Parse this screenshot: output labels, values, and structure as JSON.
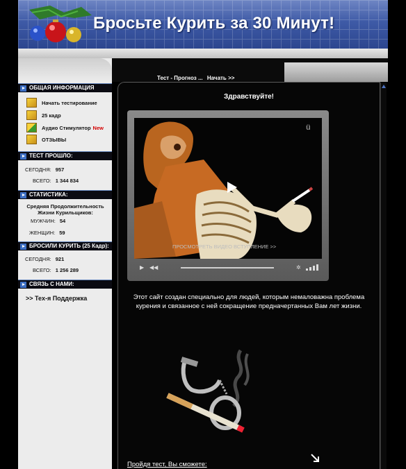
{
  "header": {
    "title": "Бросьте Курить за 30 Минут!"
  },
  "breadcrumb": {
    "test": "Тест - Прогноз ...",
    "start": "Начать >>"
  },
  "sidebar": {
    "general": {
      "heading": "ОБЩАЯ ИНФОРМАЦИЯ",
      "items": [
        {
          "label": "Начать тестирование",
          "icon": "cube-icon"
        },
        {
          "label": "25 кадр",
          "icon": "cube-icon"
        },
        {
          "label": "Аудио Стимулятор",
          "badge": "New",
          "icon": "cube-icon"
        },
        {
          "label": "ОТЗЫВЫ",
          "icon": "cube-icon"
        }
      ]
    },
    "test_passed": {
      "heading": "ТЕСТ ПРОШЛО:",
      "today_label": "СЕГОДНЯ:",
      "today_value": "957",
      "total_label": "ВСЕГО:",
      "total_value": "1 344 834"
    },
    "stats": {
      "heading": "СТАТИСТИКА:",
      "avg_label": "Средняя Продолжительность Жизни Курильщиков:",
      "men_label": "МУЖЧИН:",
      "men_value": "54",
      "women_label": "ЖЕНЩИН:",
      "women_value": "59"
    },
    "quit": {
      "heading": "БРОСИЛИ КУРИТЬ (25 Кадр):",
      "today_label": "СЕГОДНЯ:",
      "today_value": "921",
      "total_label": "ВСЕГО:",
      "total_value": "1 256 289"
    },
    "contact": {
      "heading": "СВЯЗЬ С НАМИ:",
      "support": ">> Тех-я Поддержка"
    }
  },
  "main": {
    "greeting": "Здравствуйте!",
    "video_caption": "ПРОСМОТРЕТЬ ВИДЕО ВСТУПЛЕНИЕ >>",
    "intro": "Этот сайт создан специально для людей, которым немаловажна проблема курения и связанное с ней сокращение предначертанных Вам лет жизни.",
    "bottom_link": "Пройдя тест, Вы сможете:"
  },
  "colors": {
    "header_blue": "#3e5aa6",
    "accent_blue": "#3d6fc4",
    "new_red": "#d40000"
  }
}
